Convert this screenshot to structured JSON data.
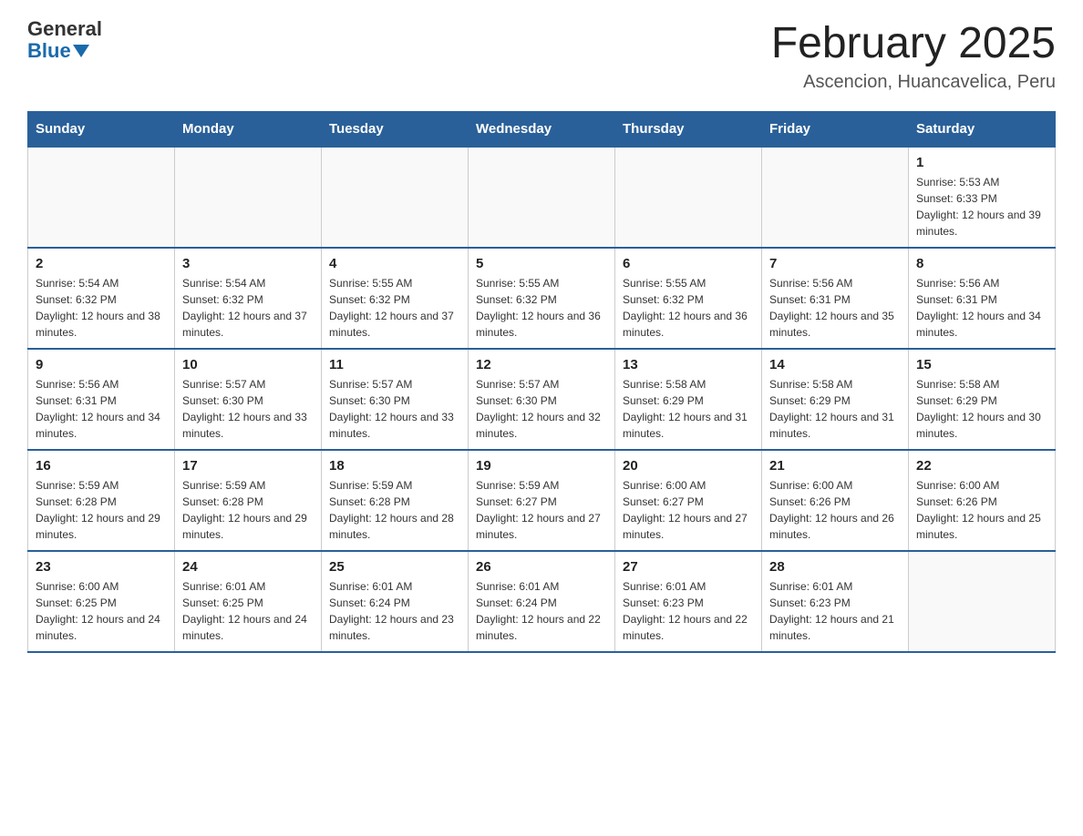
{
  "header": {
    "logo_text_general": "General",
    "logo_text_blue": "Blue",
    "month_title": "February 2025",
    "location": "Ascencion, Huancavelica, Peru"
  },
  "days_of_week": [
    "Sunday",
    "Monday",
    "Tuesday",
    "Wednesday",
    "Thursday",
    "Friday",
    "Saturday"
  ],
  "weeks": [
    [
      {
        "day": "",
        "info": ""
      },
      {
        "day": "",
        "info": ""
      },
      {
        "day": "",
        "info": ""
      },
      {
        "day": "",
        "info": ""
      },
      {
        "day": "",
        "info": ""
      },
      {
        "day": "",
        "info": ""
      },
      {
        "day": "1",
        "info": "Sunrise: 5:53 AM\nSunset: 6:33 PM\nDaylight: 12 hours and 39 minutes."
      }
    ],
    [
      {
        "day": "2",
        "info": "Sunrise: 5:54 AM\nSunset: 6:32 PM\nDaylight: 12 hours and 38 minutes."
      },
      {
        "day": "3",
        "info": "Sunrise: 5:54 AM\nSunset: 6:32 PM\nDaylight: 12 hours and 37 minutes."
      },
      {
        "day": "4",
        "info": "Sunrise: 5:55 AM\nSunset: 6:32 PM\nDaylight: 12 hours and 37 minutes."
      },
      {
        "day": "5",
        "info": "Sunrise: 5:55 AM\nSunset: 6:32 PM\nDaylight: 12 hours and 36 minutes."
      },
      {
        "day": "6",
        "info": "Sunrise: 5:55 AM\nSunset: 6:32 PM\nDaylight: 12 hours and 36 minutes."
      },
      {
        "day": "7",
        "info": "Sunrise: 5:56 AM\nSunset: 6:31 PM\nDaylight: 12 hours and 35 minutes."
      },
      {
        "day": "8",
        "info": "Sunrise: 5:56 AM\nSunset: 6:31 PM\nDaylight: 12 hours and 34 minutes."
      }
    ],
    [
      {
        "day": "9",
        "info": "Sunrise: 5:56 AM\nSunset: 6:31 PM\nDaylight: 12 hours and 34 minutes."
      },
      {
        "day": "10",
        "info": "Sunrise: 5:57 AM\nSunset: 6:30 PM\nDaylight: 12 hours and 33 minutes."
      },
      {
        "day": "11",
        "info": "Sunrise: 5:57 AM\nSunset: 6:30 PM\nDaylight: 12 hours and 33 minutes."
      },
      {
        "day": "12",
        "info": "Sunrise: 5:57 AM\nSunset: 6:30 PM\nDaylight: 12 hours and 32 minutes."
      },
      {
        "day": "13",
        "info": "Sunrise: 5:58 AM\nSunset: 6:29 PM\nDaylight: 12 hours and 31 minutes."
      },
      {
        "day": "14",
        "info": "Sunrise: 5:58 AM\nSunset: 6:29 PM\nDaylight: 12 hours and 31 minutes."
      },
      {
        "day": "15",
        "info": "Sunrise: 5:58 AM\nSunset: 6:29 PM\nDaylight: 12 hours and 30 minutes."
      }
    ],
    [
      {
        "day": "16",
        "info": "Sunrise: 5:59 AM\nSunset: 6:28 PM\nDaylight: 12 hours and 29 minutes."
      },
      {
        "day": "17",
        "info": "Sunrise: 5:59 AM\nSunset: 6:28 PM\nDaylight: 12 hours and 29 minutes."
      },
      {
        "day": "18",
        "info": "Sunrise: 5:59 AM\nSunset: 6:28 PM\nDaylight: 12 hours and 28 minutes."
      },
      {
        "day": "19",
        "info": "Sunrise: 5:59 AM\nSunset: 6:27 PM\nDaylight: 12 hours and 27 minutes."
      },
      {
        "day": "20",
        "info": "Sunrise: 6:00 AM\nSunset: 6:27 PM\nDaylight: 12 hours and 27 minutes."
      },
      {
        "day": "21",
        "info": "Sunrise: 6:00 AM\nSunset: 6:26 PM\nDaylight: 12 hours and 26 minutes."
      },
      {
        "day": "22",
        "info": "Sunrise: 6:00 AM\nSunset: 6:26 PM\nDaylight: 12 hours and 25 minutes."
      }
    ],
    [
      {
        "day": "23",
        "info": "Sunrise: 6:00 AM\nSunset: 6:25 PM\nDaylight: 12 hours and 24 minutes."
      },
      {
        "day": "24",
        "info": "Sunrise: 6:01 AM\nSunset: 6:25 PM\nDaylight: 12 hours and 24 minutes."
      },
      {
        "day": "25",
        "info": "Sunrise: 6:01 AM\nSunset: 6:24 PM\nDaylight: 12 hours and 23 minutes."
      },
      {
        "day": "26",
        "info": "Sunrise: 6:01 AM\nSunset: 6:24 PM\nDaylight: 12 hours and 22 minutes."
      },
      {
        "day": "27",
        "info": "Sunrise: 6:01 AM\nSunset: 6:23 PM\nDaylight: 12 hours and 22 minutes."
      },
      {
        "day": "28",
        "info": "Sunrise: 6:01 AM\nSunset: 6:23 PM\nDaylight: 12 hours and 21 minutes."
      },
      {
        "day": "",
        "info": ""
      }
    ]
  ]
}
